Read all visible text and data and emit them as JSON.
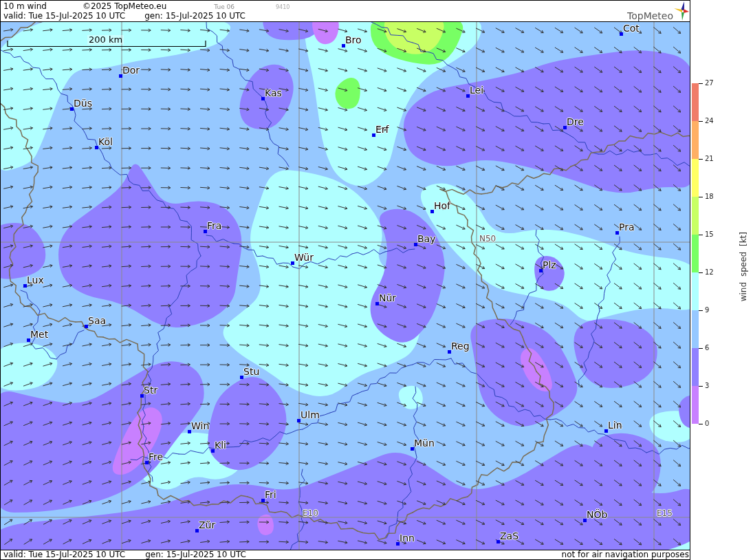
{
  "header": {
    "title": "10 m wind",
    "copyright": "©2025 TopMeteo.eu",
    "run_label": "Tue 06",
    "code": "9410",
    "valid": "valid: Tue 15-Jul-2025 10 UTC",
    "generated": "gen: 15-Jul-2025 10 UTC",
    "logo": "TopMeteo"
  },
  "map": {
    "scale": "200 km",
    "grid_labels": [
      "N50",
      "E10",
      "E15"
    ],
    "cities": [
      "Cot",
      "Bro",
      "Dor",
      "Lei",
      "Kas",
      "Düs",
      "Dre",
      "Erf",
      "Köl",
      "Hof",
      "Fra",
      "Pra",
      "Bay",
      "Wür",
      "Plz",
      "Lux",
      "Nür",
      "Saa",
      "Met",
      "Reg",
      "Stu",
      "Str",
      "Ulm",
      "Lin",
      "Win",
      "Mün",
      "Kli",
      "Fre",
      "Fri",
      "NÖb",
      "Zür",
      "ZaS",
      "Inn"
    ]
  },
  "legend": {
    "title": "wind speed [kt]",
    "bands": [
      {
        "color": "#f07c68"
      },
      {
        "color": "#ffb064"
      },
      {
        "color": "#ffff64"
      },
      {
        "color": "#c8ff64"
      },
      {
        "color": "#78ff64"
      },
      {
        "color": "#b0ffff"
      },
      {
        "color": "#96c8ff"
      },
      {
        "color": "#9080ff"
      },
      {
        "color": "#c880ff"
      }
    ],
    "ticks": [
      "27",
      "24",
      "21",
      "18",
      "15",
      "12",
      "9",
      "6",
      "3",
      "0"
    ]
  },
  "footer": {
    "valid": "valid: Tue 15-Jul-2025 10 UTC",
    "generated": "gen: 15-Jul-2025 10 UTC",
    "disclaimer": "not for air navigation purposes"
  }
}
